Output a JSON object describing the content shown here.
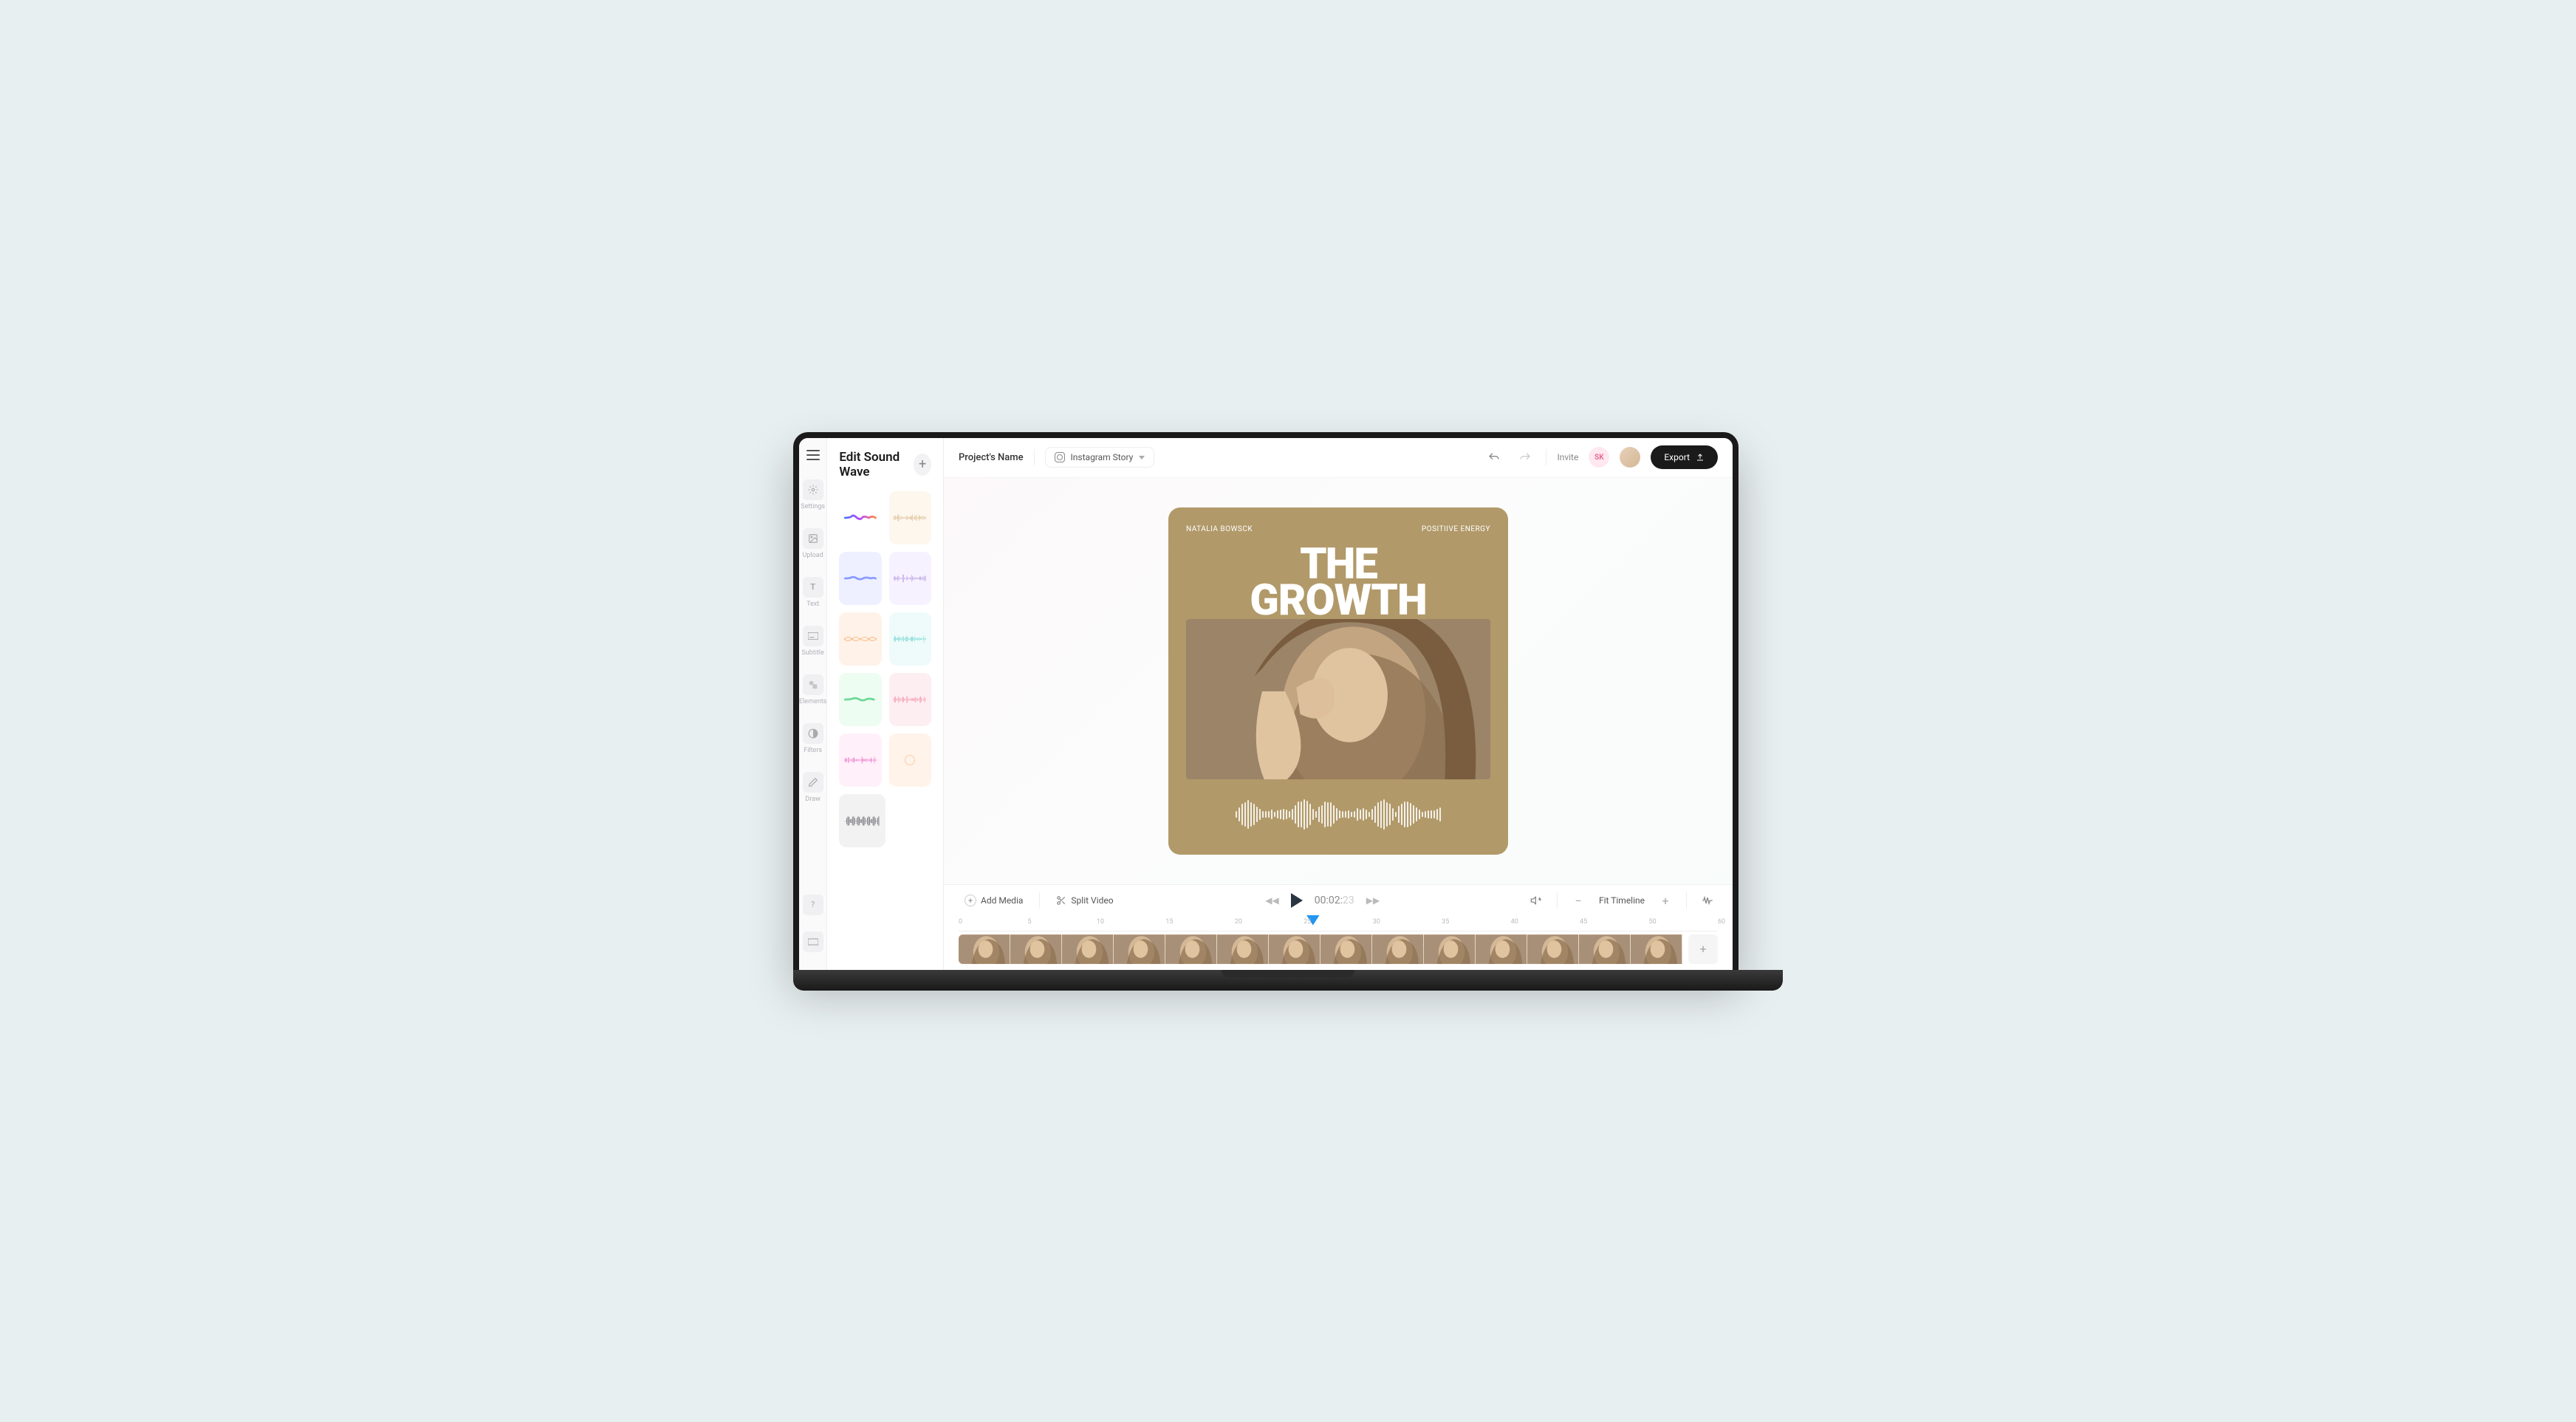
{
  "panel": {
    "title": "Edit Sound Wave"
  },
  "rail": {
    "items": [
      {
        "label": "Settings"
      },
      {
        "label": "Upload"
      },
      {
        "label": "Text"
      },
      {
        "label": "Subtitle"
      },
      {
        "label": "Elements"
      },
      {
        "label": "Filters"
      },
      {
        "label": "Draw"
      }
    ]
  },
  "topbar": {
    "project": "Project's Name",
    "format": "Instagram Story",
    "invite": "Invite",
    "avatar_initials": "SK",
    "export": "Export"
  },
  "canvas": {
    "author": "NATALIA BOWSCK",
    "tag": "POSITIIVE ENERGY",
    "title_line1": "THE",
    "title_line2": "GROWTH"
  },
  "timeline": {
    "add_media": "Add Media",
    "split_video": "Split Video",
    "time_prefix": "00:02:",
    "time_suffix": "23",
    "fit": "Fit Timeline",
    "ruler_ticks": [
      "0",
      "5",
      "10",
      "15",
      "20",
      "25",
      "30",
      "35",
      "40",
      "45",
      "50",
      "60"
    ],
    "frame_count": 14
  },
  "wave_styles": [
    {
      "bg": "#ffffff",
      "type": "blob-gradient"
    },
    {
      "bg": "#fdf7ee",
      "type": "bars-tan"
    },
    {
      "bg": "#eef0ff",
      "type": "blob-purple"
    },
    {
      "bg": "#f7f2ff",
      "type": "bars-purple"
    },
    {
      "bg": "#fff2e8",
      "type": "line-orange"
    },
    {
      "bg": "#eefbfa",
      "type": "bars-teal"
    },
    {
      "bg": "#eefdf1",
      "type": "blob-green"
    },
    {
      "bg": "#fdeef2",
      "type": "bars-pink"
    },
    {
      "bg": "#fff0fa",
      "type": "bars-magenta"
    },
    {
      "bg": "#fff3ea",
      "type": "circle-orange"
    },
    {
      "bg": "#f2f2f2",
      "type": "block-gray"
    }
  ]
}
